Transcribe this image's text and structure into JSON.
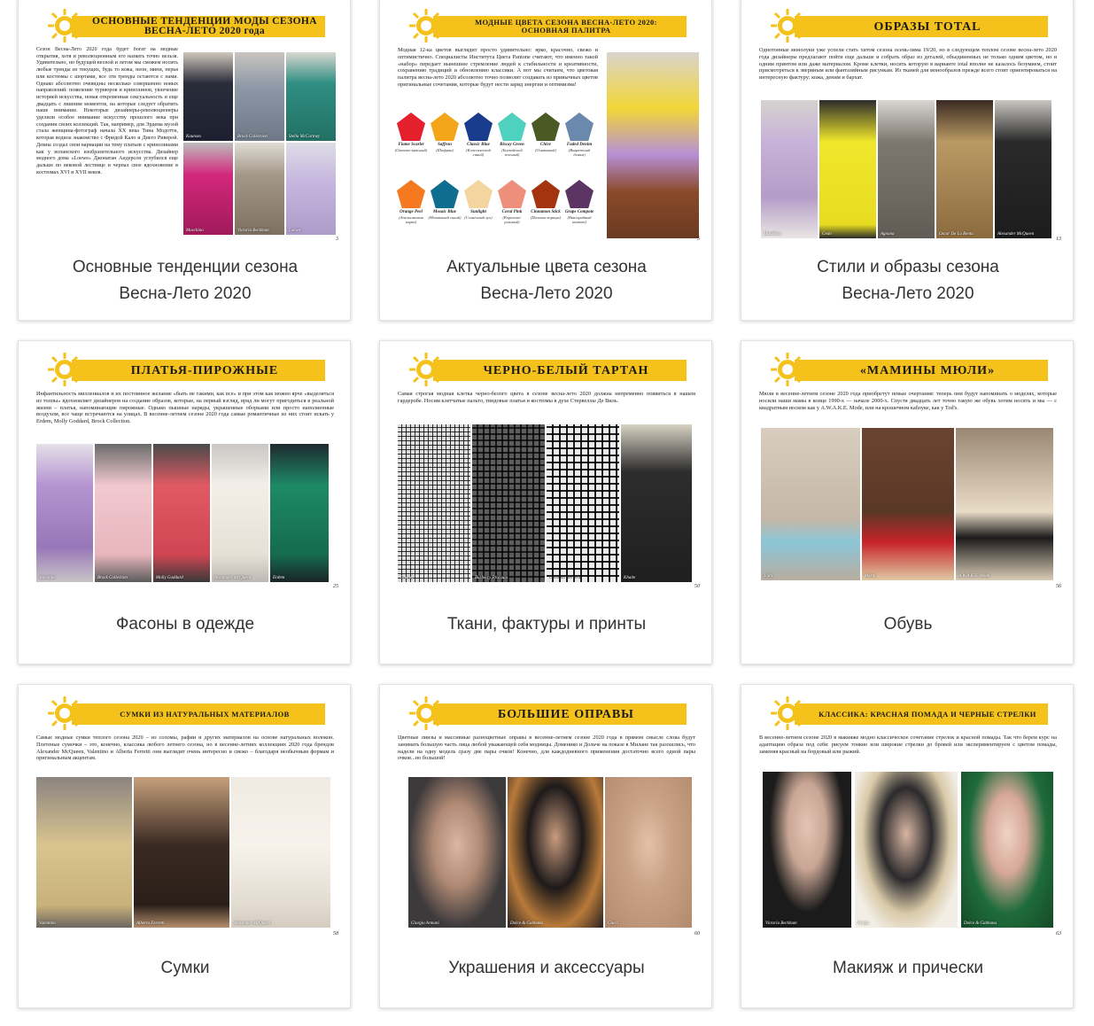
{
  "cards": [
    {
      "banner": "ОСНОВНЫЕ ТЕНДЕНЦИИ МОДЫ СЕЗОНА ВЕСНА-ЛЕТО 2020 года",
      "intro": "Сезон Весна-Лето 2020 года будет богат на модные открытия, хотя и революционным его назвать точно нельзя. Удивительно, но будущей весной и летом мы сможем носить любые тренды из текущих, будь то кожа, неон, мини, перья или костюмы с шортами, все эти тренды остаются с нами. Однако абсолютно очевидны несколько совершенно новых направлений: появление турнюров и кринолинов, увлечение историей искусства, новая откровенная сексуальность и еще двадцать с лишним моментов, на которые следует обратить наше внимание. Некоторые дизайнеры-революционеры уделили особое внимание искусству прошлого века при создании своих коллекций. Так, например, для Эрдема музой стала женщина-фотограф начала XX века Тина Модотти, которая водила знакомство с Фридой Кало и Диего Риверой. Демна создал свои вариации на тему платьев с кринолинами как у испанского изобразительного искусства. Дизайнер модного дома «Loewe» Джонатан Андерсон углубился еще дальше по вековой лестнице и черпал свое вдохновение в костюмах XVI и XVII веков.",
      "photo_labels": [
        "Kaunses",
        "Brock Collection",
        "Stella McCartney",
        "Moschino",
        "Victoria Beckham",
        "Loewe"
      ],
      "page": "3",
      "caption_line1": "Основные тенденции сезона",
      "caption_line2": "Весна-Лето 2020"
    },
    {
      "banner": "МОДНЫЕ ЦВЕТА СЕЗОНА ВЕСНА-ЛЕТО 2020: ОСНОВНАЯ ПАЛИТРА",
      "intro": "Модная 12-ка цветов выглядит просто удивительно: ярко, красочно, свежо и оптимистично. Специалисты Института Цвета Pantone считают, что именно такой «набор» передает нынешнее стремление людей к стабильности и креативности, сохранению традиций и обновлению классики. А вот мы считаем, что цветовая палитра весна-лето 2020 абсолютно точно позволит создавать из привычных цветов оригинальные сочетания, которые будут нести заряд энергии и оптимизма!",
      "swatches": [
        {
          "name": "Flame Scarlet",
          "ru": "(Огненно-красный)",
          "color": "#e3202c"
        },
        {
          "name": "Saffron",
          "ru": "(Шафран)",
          "color": "#f5a519"
        },
        {
          "name": "Classic Blue",
          "ru": "(Классический синий)",
          "color": "#1a3c8c"
        },
        {
          "name": "Biscay Green",
          "ru": "(Бискайский зеленый)",
          "color": "#4fd1c0"
        },
        {
          "name": "Chive",
          "ru": "(Оливковый)",
          "color": "#4a5a25"
        },
        {
          "name": "Faded Denim",
          "ru": "(Выцветший деним)",
          "color": "#6b88ad"
        },
        {
          "name": "Orange Peel",
          "ru": "(Апельсиновая корка)",
          "color": "#f57a1f"
        },
        {
          "name": "Mosaic Blue",
          "ru": "(Мозаичный синий)",
          "color": "#0f6e8f"
        },
        {
          "name": "Sunlight",
          "ru": "(Солнечный луч)",
          "color": "#f3d5a0"
        },
        {
          "name": "Coral Pink",
          "ru": "(Коралово-розовый)",
          "color": "#ee8f7c"
        },
        {
          "name": "Cinnamon Stick",
          "ru": "(Палочка корицы)",
          "color": "#a4340f"
        },
        {
          "name": "Grape Compote",
          "ru": "(Виноградный компот)",
          "color": "#5d3564"
        }
      ],
      "page": "5",
      "caption_line1": "Актуальные цвета сезона",
      "caption_line2": "Весна-Лето 2020"
    },
    {
      "banner": "ОБРАЗЫ TOTAL",
      "intro": "Однотонные монолуки уже успели стать хитом сезона осень-зима 19/20, но в следующем теплом сезоне весна-лето 2020 года дизайнеры предлагают пойти еще дальше и собрать образ из деталей, объединенных не только одним цветом, но и одним принтом или даже материалом. Кроме клетки, носить которую в варианте total вполне не казалось безумием, стоит присмотреться к звериным или фантазийным рисункам. Из тканей для монообразов прежде всего стоит ориентироваться на интересную фактуру: кожа, деним и бархат.",
      "photo_labels": [
        "MaxMara",
        "Gedo",
        "Agnona",
        "Oscar De La Renta",
        "Alexander McQueen"
      ],
      "page": "13",
      "caption_line1": "Стили и образы сезона",
      "caption_line2": "Весна-Лето 2020"
    },
    {
      "banner": "ПЛАТЬЯ-ПИРОЖНЫЕ",
      "intro": "Инфантильность миллениалов и их постоянное желание «быть не такими, как все» и при этом как можно ярче «выделяться из толпы» вдохновляет дизайнеров на создание образов, которые, на первый взгляд, вряд ли могут пригодиться в реальной жизни – платья, напоминающие пирожные. Однако пышные наряды, украшенные оборками или просто наполненные воздухом, все чаще встречаются на улицах. В весенне-летнем сезоне 2020 года самые романтичные из них стоит искать у Erdem, Molly Goddard, Brock Collection.",
      "photo_labels": [
        "Valentino",
        "Brock Collection",
        "Molly Goddard",
        "Alexander McQueen",
        "Erdem"
      ],
      "page": "25",
      "caption_line1": "Фасоны в одежде"
    },
    {
      "banner": "ЧЕРНО-БЕЛЫЙ ТАРТАН",
      "intro": "Самая строгая модная клетка черно-белого цвета в сезоне весна-лето 2020 должна непременно появиться в нашем гардеробе. Носим клетчатые пальто, твидовые платья и костюмы в духе Стервеллы Де Виль.",
      "photo_labels": [
        "Chanel",
        "Burberry Prorsum",
        "Carolina Herrera",
        "Khaite"
      ],
      "page": "50",
      "caption_line1": "Ткани, фактуры и принты"
    },
    {
      "banner": "«МАМИНЫ МЮЛИ»",
      "intro": "Мюли в весенне-летнем сезоне 2020 года приобретут новые очертания: теперь они будут напоминать о моделях, которые носили наши мамы в конце 1990-х — начале 2000-х. Спустя двадцать лет точно такую же обувь хотим носить и мы — с квадратным носком как у A.W.A.K.E. Mode, или на крошечном каблуке, как у Tod's.",
      "photo_labels": [
        "Tod's",
        "Marni",
        "A.W.A.K.E. Mode"
      ],
      "page": "56",
      "caption_line1": "Обувь"
    },
    {
      "banner": "СУМКИ ИЗ НАТУРАЛЬНЫХ МАТЕРИАЛОВ",
      "intro": "Самые модные сумки теплого сезона 2020 – из соломы, рафии и других материалов на основе натуральных волокон. Плетеные сумочки – это, конечно, классика любого летнего сезона, но в весенне-летних коллекциях 2020 года брендов Alexander McQueen, Valentino и Alberta Ferretti они выглядят очень интересно и свежо – благодаря необычным формам и оригинальным акцентам.",
      "photo_labels": [
        "Valentino",
        "Alberta Ferretti",
        "Alexander McQueen"
      ],
      "page": "58",
      "caption_line1": "Сумки"
    },
    {
      "banner": "БОЛЬШИЕ ОПРАВЫ",
      "intro": "Цветные линзы и массивные разноцветные оправы в весенне-летнем сезоне 2020 года в прямом смысле слова будут занимать большую часть лица любой уважающей себя модницы. Доменико и Дольче на показе в Милане так разошлись, что надели на одну модель сразу две пары очков! Конечно, для каждодневного применения достаточно всего одной пары очков...но большой!",
      "photo_labels": [
        "Giorgio Armani",
        "Dolce & Gabbana",
        "Gucci"
      ],
      "page": "60",
      "caption_line1": "Украшения и аксессуары"
    },
    {
      "banner": "КЛАССИКА: КРАСНАЯ ПОМАДА И ЧЕРНЫЕ СТРЕЛКИ",
      "intro": "В весенне-летнем сезоне 2020 в макияже модно классическое сочетание стрелок и красной помады. Так что берем курс на адаптацию образа под себя: рисуем тонкие или широкие стрелки до бровей или экспериментируем с цветом помады, заменяя красный на бордовый или рыжий.",
      "photo_labels": [
        "Victoria Beckham",
        "Prada",
        "Dolce & Gabbana"
      ],
      "page": "63",
      "caption_line1": "Макияж и прически"
    }
  ]
}
